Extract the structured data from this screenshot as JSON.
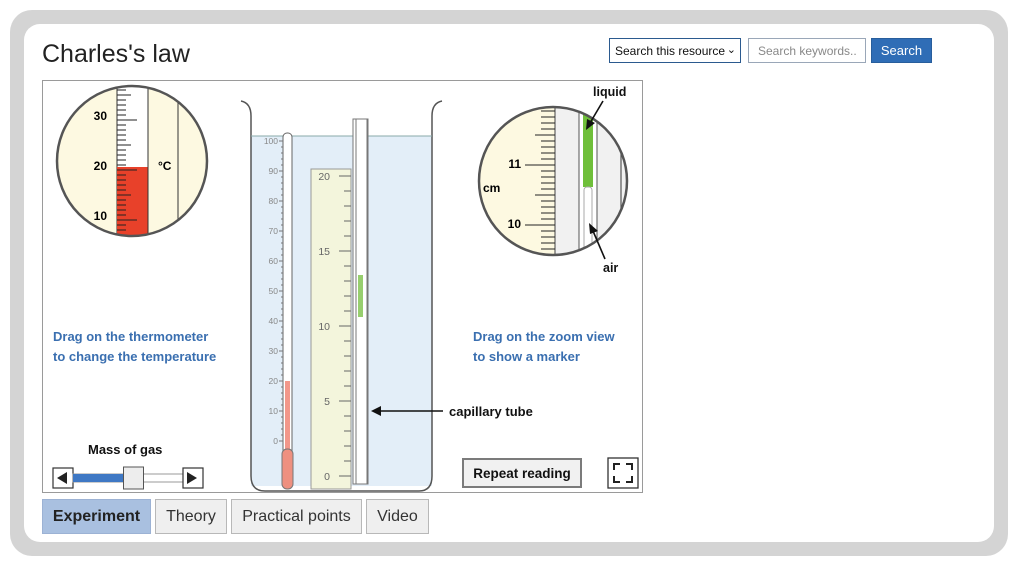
{
  "page": {
    "title": "Charles's law"
  },
  "search": {
    "scope_selected": "Search this resource",
    "placeholder": "Search keywords..",
    "button_label": "Search"
  },
  "simulation": {
    "thermometer_zoom": {
      "ticks": [
        "30",
        "20",
        "10"
      ],
      "unit": "°C"
    },
    "tube_zoom": {
      "ticks": [
        "11",
        "10"
      ],
      "unit": "cm",
      "label_liquid": "liquid",
      "label_air": "air"
    },
    "thermometer_scale": [
      "100",
      "90",
      "80",
      "70",
      "60",
      "50",
      "40",
      "30",
      "20",
      "10",
      "0"
    ],
    "ruler_scale": [
      "20",
      "15",
      "10",
      "5",
      "0"
    ],
    "hint_left_line1": "Drag on the thermometer",
    "hint_left_line2": "to change the temperature",
    "hint_right_line1": "Drag on the zoom view",
    "hint_right_line2": "to show a marker",
    "capillary_label": "capillary tube",
    "slider_label": "Mass of gas",
    "slider_value_fraction": 0.55,
    "repeat_button": "Repeat reading",
    "colors": {
      "mercury": "#e8412a",
      "liquid_index": "#6fbf3a",
      "water": "#e3eef8",
      "ruler": "#f3f5dc",
      "hint": "#3a6fb0"
    }
  },
  "tabs": [
    {
      "label": "Experiment",
      "active": true
    },
    {
      "label": "Theory",
      "active": false
    },
    {
      "label": "Practical points",
      "active": false
    },
    {
      "label": "Video",
      "active": false
    }
  ]
}
